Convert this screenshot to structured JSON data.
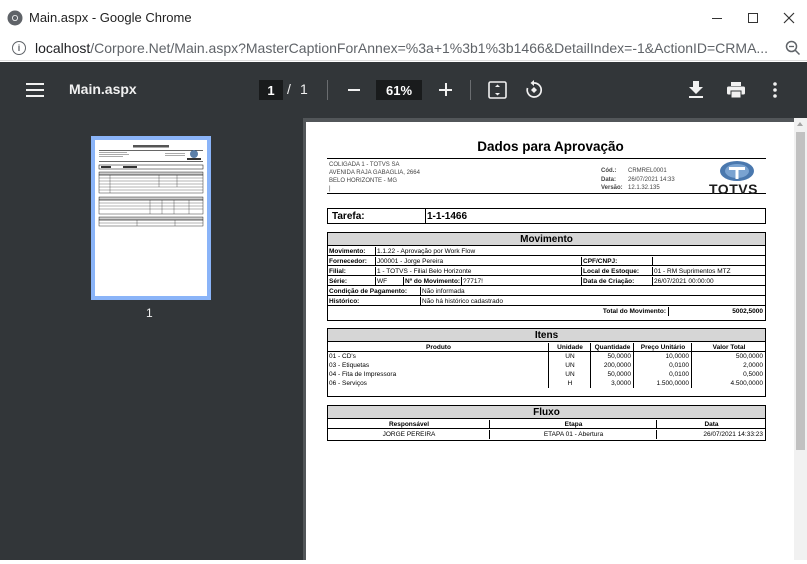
{
  "window": {
    "title": "Main.aspx - Google Chrome",
    "minimize": "—",
    "maximize": "☐",
    "close": "✕"
  },
  "address": {
    "host": "localhost",
    "rest": "/Corpore.Net/Main.aspx?MasterCaptionForAnnex=%3a+1%3b1%3b1466&DetailIndex=-1&ActionID=CRMA..."
  },
  "pdf_toolbar": {
    "doc_name": "Main.aspx",
    "current_page": "1",
    "separator": "/",
    "total_pages": "1",
    "zoom": "61%"
  },
  "sidebar": {
    "thumbnail_label": "1"
  },
  "report": {
    "title": "Dados para Aprovação",
    "company": {
      "line1": "COLIGADA 1 - TOTVS SA",
      "line2": "AVENIDA RAJA GABAGLIA, 2664",
      "line3": "BELO HORIZONTE - MG",
      "line4": "|"
    },
    "meta": {
      "cod_label": "Cód.:",
      "cod_value": "CRMREL0001",
      "data_label": "Data:",
      "data_value": "26/07/2021 14:33",
      "versao_label": "Versão:",
      "versao_value": "12.1.32.135"
    },
    "logo_text": "TOTVS",
    "tarefa_label": "Tarefa:",
    "tarefa_value": "1-1-1466",
    "movimento": {
      "title": "Movimento",
      "movimento_label": "Movimento:",
      "movimento_value": "1.1.22 - Aprovação por Work Flow",
      "fornecedor_label": "Fornecedor:",
      "fornecedor_value": "J00001 - Jorge Pereira",
      "cpf_label": "CPF/CNPJ:",
      "cpf_value": "",
      "filial_label": "Filial:",
      "filial_value": "1 - TOTVS - Filial Belo Horizonte",
      "local_label": "Local de Estoque:",
      "local_value": "01 - RM Suprimentos MTZ",
      "serie_label": "Série:",
      "serie_value": "WF",
      "numero_label": "Nº do Movimento:",
      "numero_value": "?7717!",
      "criacao_label": "Data de Criação:",
      "criacao_value": "26/07/2021 00:00:00",
      "condicao_label": "Condição de Pagamento:",
      "condicao_value": "Não informada",
      "historico_label": "Histórico:",
      "historico_value": "Não há histórico cadastrado",
      "total_label": "Total do Movimento:",
      "total_value": "5002,5000"
    },
    "itens": {
      "title": "Itens",
      "headers": [
        "Produto",
        "Unidade",
        "Quantidade",
        "Preço Unitário",
        "Valor Total"
      ],
      "rows": [
        [
          "01 - CD's",
          "UN",
          "50,0000",
          "10,0000",
          "500,0000"
        ],
        [
          "03 - Etiquetas",
          "UN",
          "200,0000",
          "0,0100",
          "2,0000"
        ],
        [
          "04 - Fita de Impressora",
          "UN",
          "50,0000",
          "0,0100",
          "0,5000"
        ],
        [
          "06 - Serviços",
          "H",
          "3,0000",
          "1.500,0000",
          "4.500,0000"
        ]
      ]
    },
    "fluxo": {
      "title": "Fluxo",
      "headers": [
        "Responsável",
        "Etapa",
        "Data"
      ],
      "rows": [
        [
          "JORGE PEREIRA",
          "ETAPA 01 - Abertura",
          "26/07/2021 14:33:23"
        ]
      ]
    }
  }
}
